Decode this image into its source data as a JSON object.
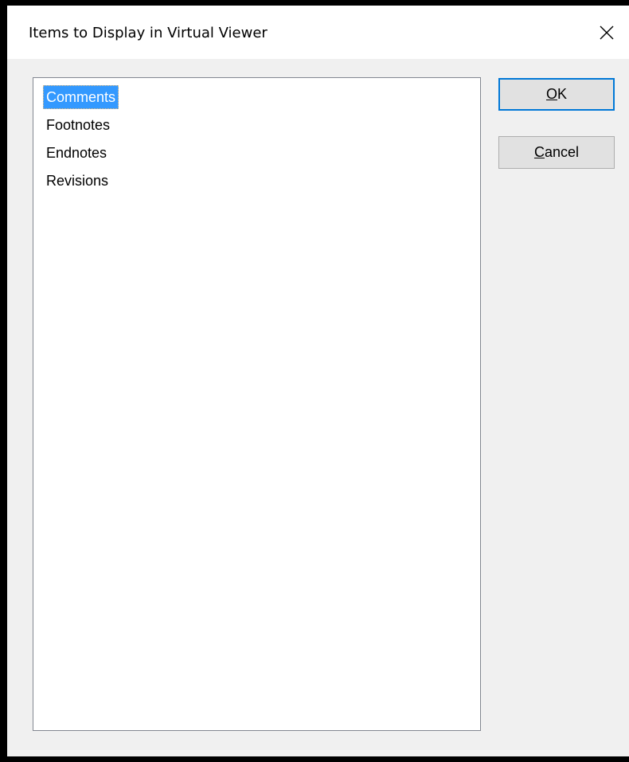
{
  "dialog": {
    "title": "Items to Display in Virtual Viewer",
    "close_icon": "close-icon"
  },
  "list": {
    "items": [
      {
        "label": "Comments",
        "selected": true
      },
      {
        "label": "Footnotes",
        "selected": false
      },
      {
        "label": "Endnotes",
        "selected": false
      },
      {
        "label": "Revisions",
        "selected": false
      }
    ]
  },
  "buttons": {
    "ok": {
      "mnemonic": "O",
      "rest": "K"
    },
    "cancel": {
      "mnemonic": "C",
      "rest": "ancel"
    }
  },
  "colors": {
    "selection": "#3399ff",
    "default_button_border": "#0078d7"
  }
}
